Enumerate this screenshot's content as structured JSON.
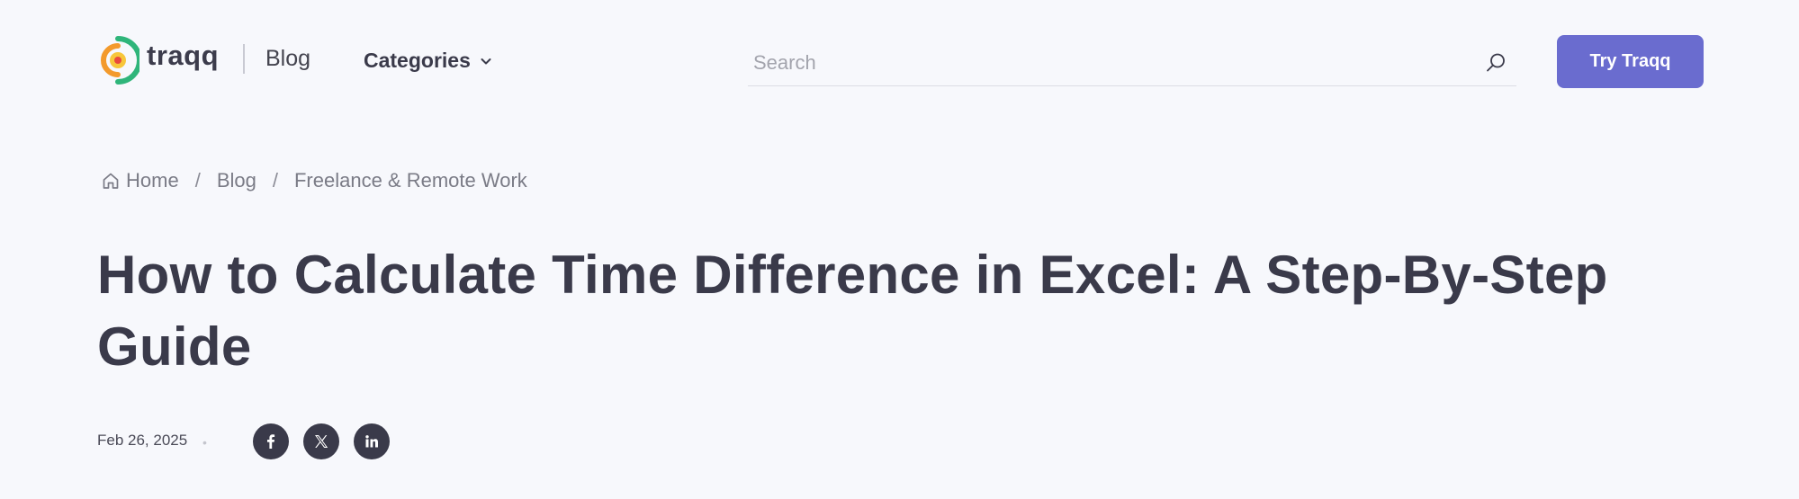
{
  "header": {
    "brand": "traqq",
    "blog_label": "Blog",
    "categories_label": "Categories",
    "search_placeholder": "Search",
    "try_button_label": "Try Traqq"
  },
  "breadcrumb": {
    "home": "Home",
    "blog": "Blog",
    "category": "Freelance & Remote Work",
    "separator": "/"
  },
  "article": {
    "title": "How to Calculate Time Difference in Excel: A Step-By-Step Guide",
    "date": "Feb 26, 2025",
    "meta_dot": "•"
  },
  "share": {
    "icons": [
      "facebook-icon",
      "x-icon",
      "linkedin-icon"
    ]
  },
  "colors": {
    "background": "#f7f8fc",
    "text": "#3a3a4a",
    "accent_button": "#6a6ccf",
    "logo_green": "#2fb57a",
    "logo_orange": "#f39a2c",
    "logo_yellow": "#f7c63a",
    "logo_red": "#e94a3c"
  }
}
